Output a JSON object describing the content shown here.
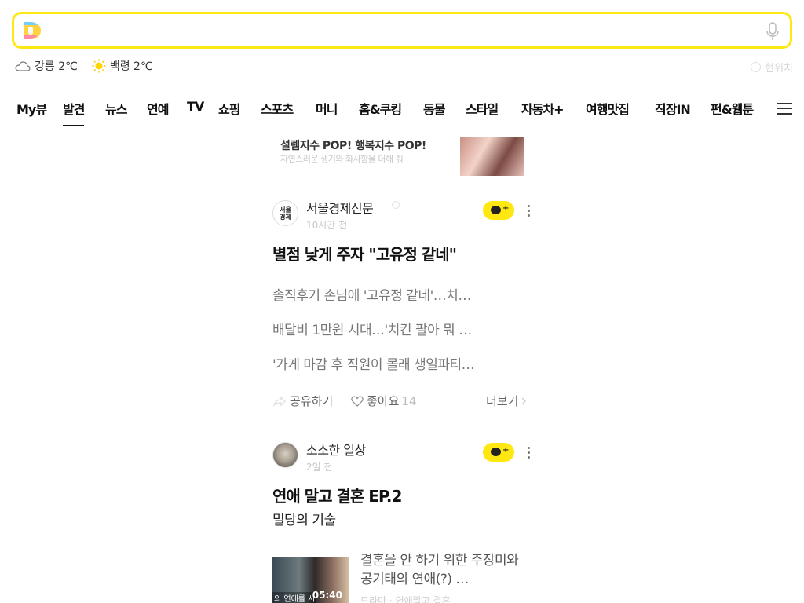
{
  "search": {
    "placeholder": "",
    "value": ""
  },
  "weather": {
    "items": [
      {
        "place": "강릉 2℃",
        "icon": "cloud-icon"
      },
      {
        "place": "백령 2℃",
        "icon": "sun-icon"
      }
    ],
    "right_label": "현위치"
  },
  "nav": {
    "tabs": [
      "My뷰",
      "발견",
      "뉴스",
      "연예",
      "TV",
      "쇼핑",
      "스포츠",
      "머니",
      "홈&쿠킹",
      "동물",
      "스타일",
      "자동차+",
      "여행맛집",
      "직장IN",
      "펀&웹툰"
    ],
    "active": "발견"
  },
  "banner": {
    "title": "설렘지수 POP! 행복지수 POP!",
    "subtitle": "자연스러운 생기와 화사함을 더해 줘"
  },
  "cards": [
    {
      "source": "서울경제신문",
      "avatar_text": "서울\n경제",
      "time": "10시간 전",
      "headline": "별점 낮게 주자 \"고유정 같네\"",
      "related": [
        "솔직후기 손님에 '고유정 같네'…치…",
        "배달비 1만원 시대…'치킨 팔아 뭐 …",
        "'가게 마감 후 직원이 몰래 생일파티…"
      ],
      "share_label": "공유하기",
      "like_label": "좋아요",
      "like_count": "14",
      "more_label": "더보기"
    },
    {
      "source": "소소한 일상",
      "time": "2일 전",
      "headline": "연애 말고 결혼 EP.2",
      "subhead": "밀당의 기술",
      "video": {
        "duration": "05:40",
        "caption": "의 연애를 시",
        "title": "결혼을 안 하기 위한 주장미와 공기태의 연애(?) …",
        "meta": "드라마 · 연애말고 결혼"
      }
    }
  ],
  "colors": {
    "accent": "#ffe812",
    "text": "#222222",
    "muted": "#777777"
  }
}
